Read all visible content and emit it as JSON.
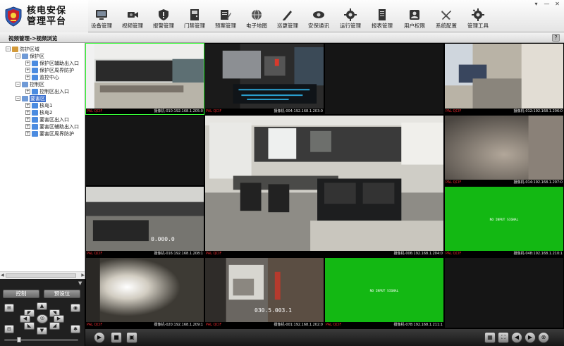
{
  "app": {
    "title_line1": "核电安保",
    "title_line2": "管理平台",
    "window_controls": [
      "▾",
      "—",
      "✕"
    ]
  },
  "nav": [
    {
      "label": "设备管理",
      "icon": "monitor-icon"
    },
    {
      "label": "视频管理",
      "icon": "camera-icon"
    },
    {
      "label": "报警管理",
      "icon": "shield-alarm-icon"
    },
    {
      "label": "门禁管理",
      "icon": "door-access-icon"
    },
    {
      "label": "预案管理",
      "icon": "plan-edit-icon"
    },
    {
      "label": "电子地图",
      "icon": "globe-map-icon"
    },
    {
      "label": "巡更管理",
      "icon": "patrol-pen-icon"
    },
    {
      "label": "安保通讯",
      "icon": "phone-icon"
    },
    {
      "label": "运行管理",
      "icon": "operation-gear-icon"
    },
    {
      "label": "报表管理",
      "icon": "report-book-icon"
    },
    {
      "label": "用户权限",
      "icon": "user-permission-icon"
    },
    {
      "label": "系统配置",
      "icon": "tools-icon"
    },
    {
      "label": "管理工具",
      "icon": "settings-gear-icon"
    }
  ],
  "breadcrumb": "视频管理->视频浏览",
  "help_label": "?",
  "tree": {
    "root": "防护区域",
    "groups": [
      {
        "label": "保护区",
        "children": [
          "保护区辅助出入口",
          "保护区周界防护",
          "监控中心"
        ]
      },
      {
        "label": "控制区",
        "children": [
          "控制区出入口"
        ]
      },
      {
        "label": "要害区",
        "children": [
          "核岛1",
          "核岛2",
          "要害区出入口",
          "要害区辅助出入口",
          "要害区周界防护"
        ],
        "selected": true
      }
    ]
  },
  "ptz": {
    "tab_control": "控制",
    "tab_preset": "预设位",
    "up": "▲",
    "down": "▼",
    "left": "◀",
    "right": "▶",
    "center": "◎",
    "speed_level": 0.18
  },
  "video": {
    "format": "PAL QCIF",
    "no_signal": "NO INPUT SIGNAL",
    "cells": [
      {
        "camera": "摄像机-010:192.168.1.205:0",
        "active": true
      },
      {
        "camera": "摄像机-004:192.168.1.203:0"
      },
      {
        "camera": ""
      },
      {
        "camera": "摄像机-012:192.168.1.206:0"
      },
      {
        "camera": "摄像机-006:192.168.1.204:0"
      },
      {
        "camera": "摄像机-014:192.168.1.207:0"
      },
      {
        "camera": ""
      },
      {
        "camera": "摄像机-016:192.168.1.208:1",
        "overlay": "0.000.0"
      },
      {
        "camera": "摄像机-048:192.168.1.210:1",
        "no_signal": true
      },
      {
        "camera": "摄像机-020:192.168.1.209:1"
      },
      {
        "camera": "摄像机-001:192.168.1.202:0",
        "overlay": "030.5.003.1"
      },
      {
        "camera": "摄像机-078:192.168.1.211:1",
        "no_signal": true
      },
      {
        "camera": ""
      }
    ]
  },
  "toolbar": {
    "play": "▶",
    "stop": "■",
    "record": "▣",
    "layout": "▦",
    "fullscreen": "⛶",
    "prev": "◀",
    "next": "▶",
    "close": "⊗"
  }
}
